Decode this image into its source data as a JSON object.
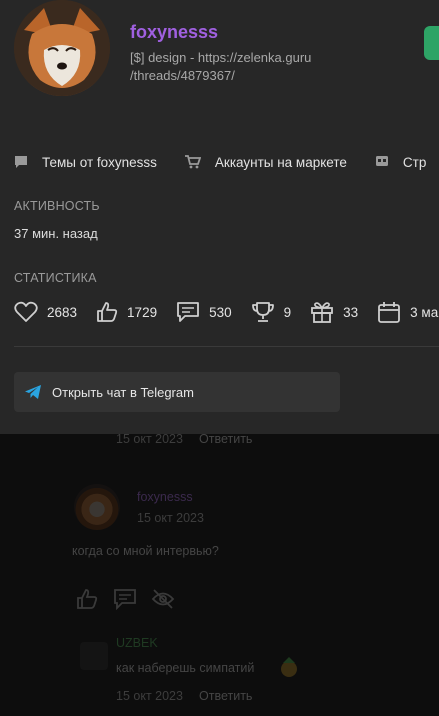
{
  "profile": {
    "username": "foxynesss",
    "bio_line1": "[$] design - https://zelenka.guru",
    "bio_line2": "/threads/4879367/"
  },
  "nav": [
    {
      "label": "Темы от foxynesss",
      "icon": "chat-bubble-icon"
    },
    {
      "label": "Аккаунты на маркете",
      "icon": "cart-icon"
    },
    {
      "label": "Стр",
      "icon": "page-icon"
    }
  ],
  "activity": {
    "title": "АКТИВНОСТЬ",
    "value": "37 мин. назад"
  },
  "statistics": {
    "title": "СТАТИСТИКА",
    "items": [
      {
        "icon": "heart-icon",
        "value": "2683"
      },
      {
        "icon": "thumbs-up-icon",
        "value": "1729"
      },
      {
        "icon": "message-icon",
        "value": "530"
      },
      {
        "icon": "trophy-icon",
        "value": "9"
      },
      {
        "icon": "gift-icon",
        "value": "33"
      },
      {
        "icon": "calendar-icon",
        "value": "3 ма"
      }
    ]
  },
  "telegram_button": {
    "label": "Открыть чат в Telegram",
    "icon": "telegram-icon"
  },
  "background": {
    "top_date": "15 окт 2023",
    "top_reply": "Ответить",
    "comment_author": "foxynesss",
    "comment_date": "15 окт 2023",
    "comment_text": "когда со мной интервью?",
    "reply_author": "UZBEK",
    "reply_text": "как наберешь симпатий",
    "reply_date": "15 окт 2023",
    "reply_action": "Ответить"
  },
  "colors": {
    "username": "#a060e0",
    "card_bg": "#272727",
    "page_bg": "#0d0d0d",
    "follow_button": "#2ea466",
    "telegram": "#2aa4e0"
  }
}
